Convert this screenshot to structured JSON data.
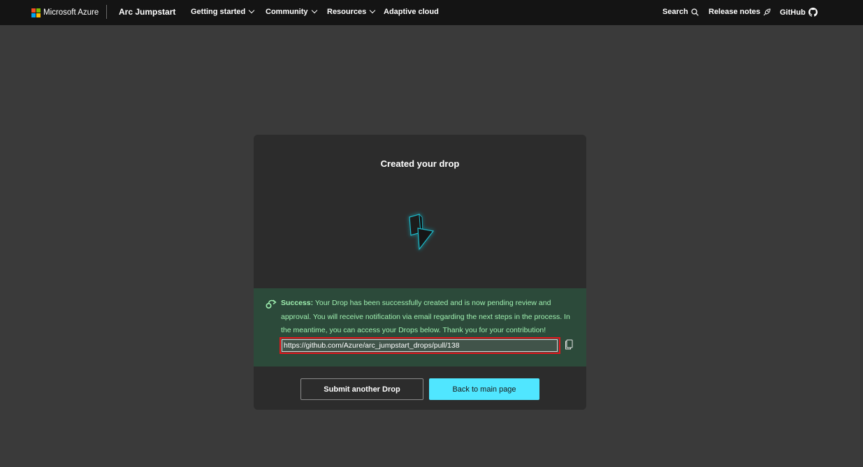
{
  "header": {
    "brand_label": "Microsoft Azure",
    "site_title": "Arc Jumpstart",
    "nav": [
      {
        "label": "Getting started",
        "icon": "chevron-down-icon"
      },
      {
        "label": "Community",
        "icon": "chevron-down-icon"
      },
      {
        "label": "Resources",
        "icon": "chevron-down-icon"
      },
      {
        "label": "Adaptive cloud"
      }
    ],
    "right_nav": [
      {
        "label": "Search",
        "icon": "search-icon"
      },
      {
        "label": "Release notes",
        "icon": "rocket-icon"
      },
      {
        "label": "GitHub",
        "icon": "github-icon"
      }
    ],
    "logo_colors": [
      "#f25022",
      "#7fba00",
      "#00a4ef",
      "#ffb900"
    ]
  },
  "card": {
    "title": "Created your drop",
    "success": {
      "label": "Success:",
      "message": " Your Drop has been successfully created and is now pending review and approval. You will receive notification via email regarding the next steps in the process. In the meantime, you can access your Drops below. Thank you for your contribution!",
      "link": "https://github.com/Azure/arc_jumpstart_drops/pull/138"
    },
    "buttons": {
      "secondary": "Submit another Drop",
      "primary": "Back to main page"
    }
  },
  "colors": {
    "accent": "#50e6ff",
    "success_text": "#9ff0b0",
    "highlight_border": "#e3161c"
  }
}
